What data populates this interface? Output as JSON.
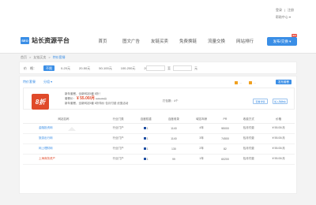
{
  "header": {
    "top_links": [
      "登录",
      "注册"
    ],
    "help": "帮助中心 ▾"
  },
  "logo": {
    "mark": "SEO",
    "text": "站长资源平台"
  },
  "nav": {
    "items": [
      "首页",
      "图文广告",
      "友链买卖",
      "免费换链",
      "流量交换",
      "网站排行"
    ],
    "publish_label": "发布/交换 ▾",
    "publish_badge": "NEW"
  },
  "breadcrumb": [
    "首页",
    "友链买卖",
    "特价套餐"
  ],
  "filter": {
    "label": "价　格：",
    "options": [
      "不限",
      "0-20元",
      "20-50元",
      "50-100元",
      "100-200元",
      "200-500元"
    ],
    "selected": "不限",
    "separator": "至",
    "unit": "元"
  },
  "tabs": [
    "特价套餐",
    "分组 ▾"
  ],
  "toolbar": {
    "check1": "...",
    "check2": "...",
    "button": "发布套餐"
  },
  "package": {
    "badge": "8折",
    "title": "新年套餐，全新网站5套 8折！",
    "price_label": "套餐价：",
    "price": "¥ 55.00/月",
    "old_price": "¥ 69.00/月",
    "note": "新年套餐，全新网站5套 8折特价 包月付费 优惠活动",
    "count": "打包数：4个",
    "btn_detail": "查看详情",
    "btn_buy": "加入购物车"
  },
  "table": {
    "headers": [
      "网站名称",
      "行业门类",
      "百度权重",
      "百度收录",
      "域名年龄",
      "PR",
      "收费方式",
      "价格"
    ],
    "rows": [
      {
        "site": "金融投资网",
        "industry": "行业门户",
        "weight": "1",
        "index": "1140",
        "age": "4年",
        "pr": "¥5000",
        "pay": "包月付费",
        "price": "¥ 55.00/月",
        "highlight": false
      },
      {
        "site": "旅游出行网",
        "industry": "行业门户",
        "weight": "1",
        "index": "1140",
        "age": "3年",
        "pr": "74500",
        "pay": "包月付费",
        "price": "¥ 55.00/月",
        "highlight": false
      },
      {
        "site": "网上理财网",
        "industry": "行业门户",
        "weight": "1",
        "index": "130",
        "age": "2年",
        "pr": "82",
        "pay": "包月付费",
        "price": "¥ 55.00/月",
        "highlight": false
      },
      {
        "site": "上海商务资产",
        "industry": "行业门户",
        "weight": "1",
        "index": "99",
        "age": "1年",
        "pr": "60200",
        "pay": "包月付费",
        "price": "¥ 55.00/月",
        "highlight": true
      }
    ]
  },
  "colors": {
    "accent": "#3a8ee6",
    "badge": "#e04a2a"
  }
}
